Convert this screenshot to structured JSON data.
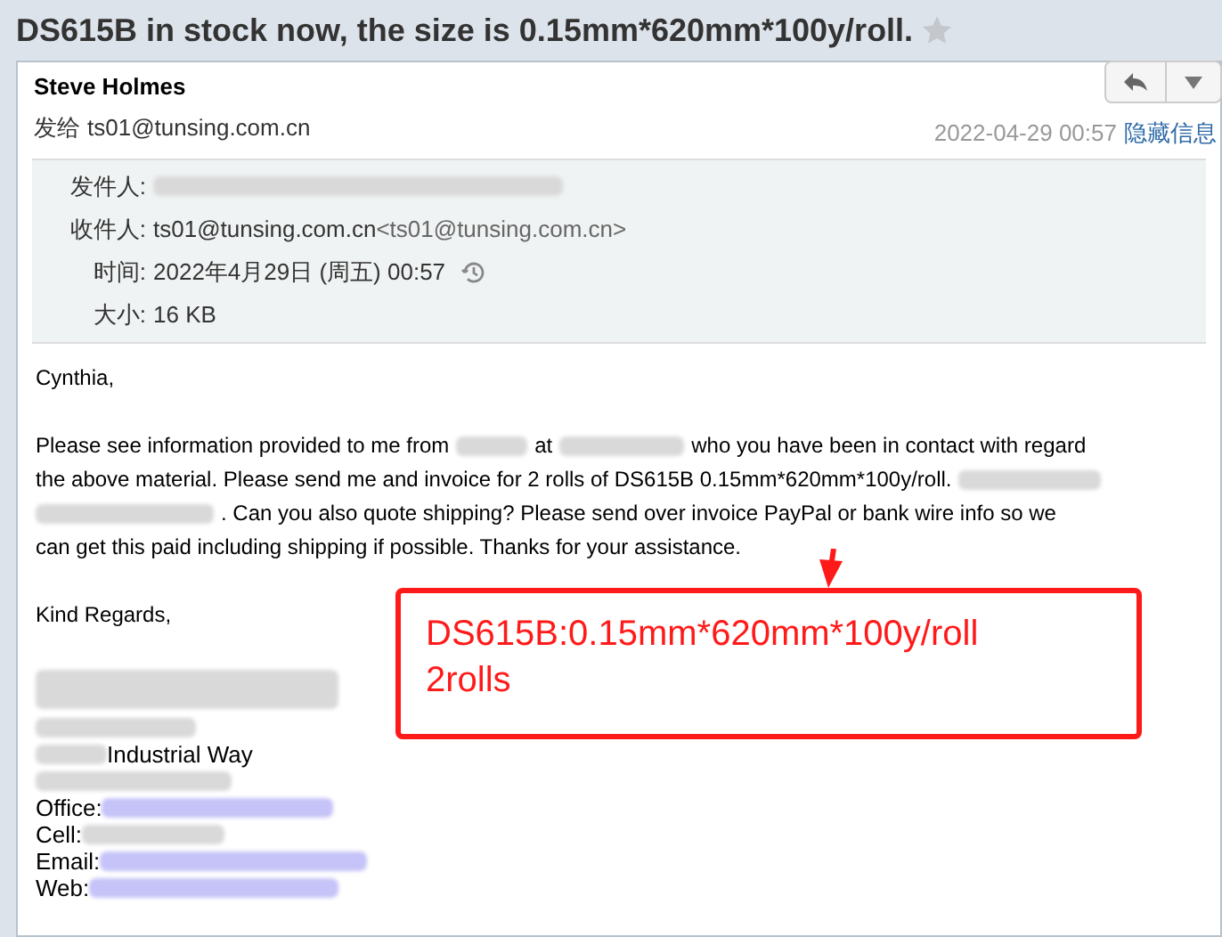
{
  "subject": "DS615B in stock now, the size is 0.15mm*620mm*100y/roll.",
  "starred": false,
  "sender": {
    "name": "Steve Holmes",
    "to_label": "发给",
    "to": "ts01@tunsing.com.cn",
    "date": "2022-04-29 00:57",
    "toggle": "隐藏信息"
  },
  "details": [
    {
      "label": "发件人:",
      "parts": [
        {
          "kind": "blur"
        }
      ]
    },
    {
      "label": "收件人:",
      "parts": [
        {
          "kind": "text",
          "text": "ts01@tunsing.com.cn"
        },
        {
          "kind": "muted",
          "text": "<ts01@tunsing.com.cn>"
        }
      ]
    },
    {
      "label": "时间:",
      "parts": [
        {
          "kind": "text",
          "text": "2022年4月29日 (周五) 00:57"
        },
        {
          "kind": "history"
        }
      ]
    },
    {
      "label": "大小:",
      "parts": [
        {
          "kind": "text",
          "text": "16 KB"
        }
      ]
    }
  ],
  "body": [
    [
      {
        "kind": "text",
        "text": "Cynthia,"
      }
    ],
    [
      {
        "kind": "text",
        "text": "Please see information provided to me from"
      },
      {
        "kind": "blur"
      },
      {
        "kind": "text",
        "text": "at"
      },
      {
        "kind": "blur"
      },
      {
        "kind": "text",
        "text": "who you have been in contact with regard"
      },
      {
        "kind": "br"
      },
      {
        "kind": "text",
        "text": "the above material. Please send me and invoice for 2 rolls of DS615B 0.15mm*620mm*100y/roll."
      },
      {
        "kind": "blur"
      },
      {
        "kind": "br"
      },
      {
        "kind": "blur"
      },
      {
        "kind": "text",
        "text": ". Can you also quote shipping? Please send over invoice PayPal or bank wire info so we"
      },
      {
        "kind": "br"
      },
      {
        "kind": "text",
        "text": "can get this paid including shipping if possible. Thanks for your assistance."
      }
    ],
    [
      {
        "kind": "text",
        "text": "Kind Regards,"
      }
    ]
  ],
  "signature": [
    [
      {
        "kind": "blur"
      }
    ],
    [
      {
        "kind": "blur"
      }
    ],
    [
      {
        "kind": "blur"
      },
      {
        "kind": "text",
        "text": "Industrial Way"
      }
    ],
    [
      {
        "kind": "blur"
      }
    ],
    [
      {
        "kind": "text",
        "text": "Office: "
      },
      {
        "kind": "link_blur"
      }
    ],
    [
      {
        "kind": "text",
        "text": "Cell: "
      },
      {
        "kind": "blur"
      }
    ],
    [
      {
        "kind": "text",
        "text": "Email: "
      },
      {
        "kind": "link_blur"
      }
    ],
    [
      {
        "kind": "text",
        "text": "Web: "
      },
      {
        "kind": "link_blur"
      }
    ]
  ],
  "annotation": {
    "lines": [
      "DS615B:0.15mm*620mm*100y/roll",
      "2rolls"
    ]
  }
}
